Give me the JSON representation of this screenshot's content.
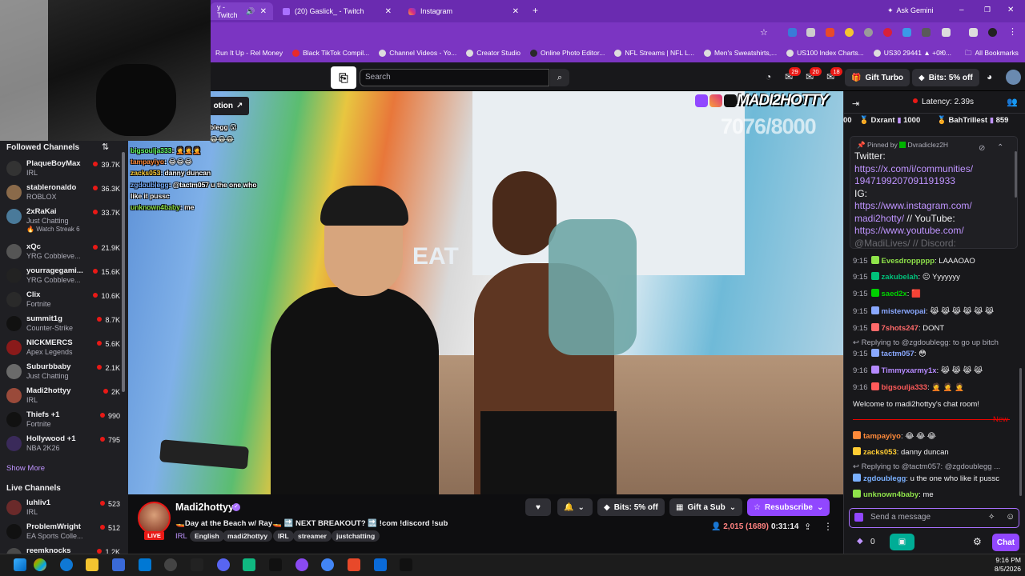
{
  "browser": {
    "tabs": [
      {
        "label": "y - Twitch",
        "active": true
      },
      {
        "label": "(20) Gaslick_ - Twitch",
        "active": false
      },
      {
        "label": "Instagram",
        "active": false
      }
    ],
    "gemini_label": "Ask Gemini",
    "bookmarks": [
      "Run It Up - Rel Money",
      "Black TikTok Compil...",
      "Channel Videos - Yo...",
      "Creator Studio",
      "Online Photo Editor...",
      "NFL Streams | NFL L...",
      "Men's Sweatshirts,...",
      "US100 Index Charts...",
      "US30 29441 ▲ +0.0..."
    ],
    "all_bookmarks": "All Bookmarks"
  },
  "nav": {
    "search_placeholder": "Search",
    "notif_counts": [
      "29",
      "20",
      "18"
    ],
    "gift_turbo": "Gift Turbo",
    "bits_offer": "Bits: 5% off"
  },
  "video": {
    "promo_label": "otion",
    "watermark": "MADI2HOTTY",
    "goal": "7076/8000",
    "street_sign": "EAT",
    "overlay_chat": [
      {
        "user": "",
        "text": "blegg 😮"
      },
      {
        "user": "",
        "text": "😂😂😂"
      },
      {
        "user": "bigsoulja333",
        "text": ": 🤦🤦🤦"
      },
      {
        "user": "tampayiyo",
        "text": ": 😂😂😂"
      },
      {
        "user": "zacks053",
        "text": ": danny duncan"
      },
      {
        "user": "zgdoublegg",
        "text": ": @tactm057 u the one who"
      },
      {
        "user": "",
        "text": "like it pussc"
      },
      {
        "user": "unknown4baby",
        "text": ": me"
      }
    ]
  },
  "sidebar": {
    "followed_title": "Followed Channels",
    "followed": [
      {
        "name": "PlaqueBoyMax",
        "game": "IRL",
        "viewers": "39.7K",
        "color": "#333"
      },
      {
        "name": "stableronaldo",
        "game": "ROBLOX",
        "viewers": "36.3K",
        "color": "#8a6a4a"
      },
      {
        "name": "2xRaKai",
        "game": "Just Chatting",
        "viewers": "33.7K",
        "color": "#4a7a9a"
      },
      {
        "name": "xQc",
        "game": "YRG Cobbleve...",
        "viewers": "21.9K",
        "color": "#555"
      },
      {
        "name": "yourragegami...",
        "game": "YRG Cobbleve...",
        "viewers": "15.6K",
        "color": "#222"
      },
      {
        "name": "Clix",
        "game": "Fortnite",
        "viewers": "10.6K",
        "color": "#2a2a2a"
      },
      {
        "name": "summit1g",
        "game": "Counter-Strike",
        "viewers": "8.7K",
        "color": "#111"
      },
      {
        "name": "NICKMERCS",
        "game": "Apex Legends",
        "viewers": "5.6K",
        "color": "#8a1a1a"
      },
      {
        "name": "Suburbbaby",
        "game": "Just Chatting",
        "viewers": "2.1K",
        "color": "#6a6a6a"
      },
      {
        "name": "Madi2hottyy",
        "game": "IRL",
        "viewers": "2K",
        "color": "#9a4a3a"
      },
      {
        "name": "Thiefs +1",
        "game": "Fortnite",
        "viewers": "990",
        "color": "#111"
      },
      {
        "name": "Hollywood +1",
        "game": "NBA 2K26",
        "viewers": "795",
        "color": "#3a2a5a"
      }
    ],
    "watch_streak": "Watch Streak 6",
    "show_more": "Show More",
    "live_title": "Live Channels",
    "live": [
      {
        "name": "luhliv1",
        "game": "IRL",
        "viewers": "523",
        "color": "#6a2a2a"
      },
      {
        "name": "ProblemWright",
        "game": "EA Sports Colle...",
        "viewers": "512",
        "color": "#111"
      },
      {
        "name": "reemknocks",
        "game": "",
        "viewers": "1.2K",
        "color": "#4a4a4a"
      }
    ]
  },
  "stream": {
    "channel": "Madi2hottyy",
    "live": "LIVE",
    "title": "🚤Day at the Beach w/ Ray🚤 🔜 NEXT BREAKOUT? 🔜 !com !discord !sub",
    "category": "IRL",
    "tags": [
      "English",
      "madi2hottyy",
      "IRL",
      "streamer",
      "justchatting"
    ],
    "bits": "Bits: 5% off",
    "gift": "Gift a Sub",
    "resub": "Resubscribe",
    "viewers": "2,015 (1689)",
    "uptime": "0:31:14"
  },
  "chat": {
    "latency": "Latency: 2.39s",
    "hype": [
      {
        "name": "00",
        "value": ""
      },
      {
        "name": "Dxrant",
        "value": "1000"
      },
      {
        "name": "BahTrillest",
        "value": "859"
      }
    ],
    "pinned_by": "Pinned by",
    "pinned_user": "Dvradiclez2H",
    "pinned_lines": [
      "Twitter:",
      "https://x.com/i/communities/1947199207091191933",
      "IG:",
      "https://www.instagram.com/madi2hotty/",
      "// YouTube:",
      "https://www.youtube.com/",
      "@MadiLives/ // Discord:"
    ],
    "messages": [
      {
        "time": "9:15",
        "user": "Evesdroppppp",
        "color": "#8fe34a",
        "text": ": LAAAOAO"
      },
      {
        "time": "9:15",
        "user": "zakubelah",
        "color": "#00c07a",
        "text": ": 😐 Yyyyyyy"
      },
      {
        "time": "9:15",
        "user": "saed2x",
        "color": "#00d000",
        "text": ": 🟥"
      },
      {
        "time": "9:15",
        "user": "misterwopai",
        "color": "#8aa8ff",
        "text": ": 😹 😹 😹 😹 😹 😹"
      },
      {
        "time": "9:15",
        "user": "7shots247",
        "color": "#ff6a6a",
        "text": ": DONT"
      },
      {
        "time": "9:15",
        "user": "tactm057",
        "color": "#8aa8ff",
        "text": ": 😳"
      },
      {
        "time": "9:16",
        "user": "Timmyxarmy1x",
        "color": "#b58aff",
        "text": ": 😹 😹 😹 😹"
      },
      {
        "time": "9:16",
        "user": "bigsoulja333",
        "color": "#ff5a5a",
        "text": ": 🤦 🤦 🤦"
      }
    ],
    "reply1": "Replying to @zgdoublegg: to go up bitch",
    "welcome": "Welcome to madi2hottyy's chat room!",
    "new_label": "New",
    "recent": [
      {
        "user": "tampayiyo",
        "color": "#ff8a3a",
        "text": ": 😂 😂 😂"
      },
      {
        "user": "zacks053",
        "color": "#ffcc33",
        "text": ": danny duncan"
      },
      {
        "user": "zgdoublegg",
        "color": "#7ab0ff",
        "text": ": u the one who like it pussc"
      },
      {
        "user": "unknown4baby",
        "color": "#8fe34a",
        "text": ": me"
      }
    ],
    "reply2": "Replying to @tactm057: @zgdoublegg ...",
    "input_placeholder": "Send a message",
    "points": "0",
    "chat_button": "Chat"
  },
  "taskbar": {
    "time": "9:16 PM",
    "date": "8/5/2026"
  }
}
